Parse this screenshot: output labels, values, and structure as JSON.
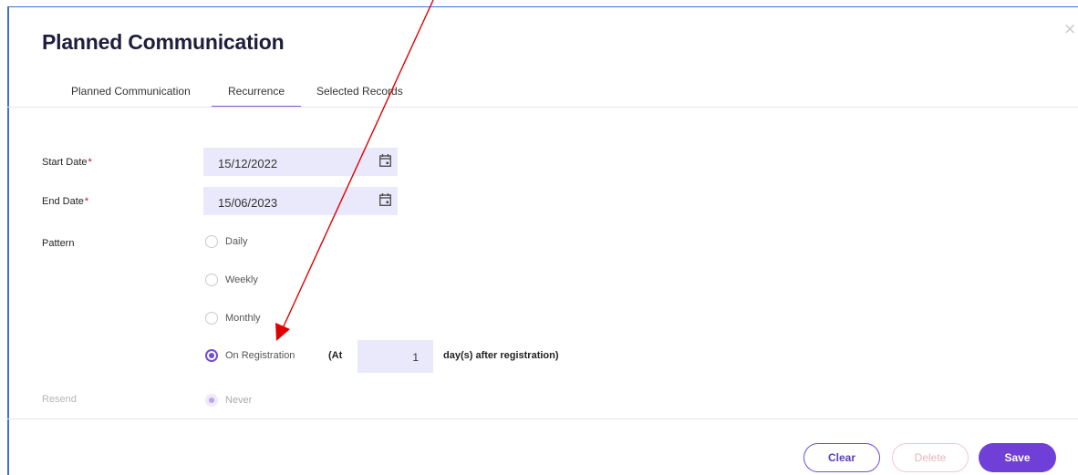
{
  "dialog": {
    "title": "Planned Communication",
    "close_symbol": "×"
  },
  "tabs": [
    {
      "label": "Planned Communication",
      "active": false
    },
    {
      "label": "Recurrence",
      "active": true
    },
    {
      "label": "Selected Records",
      "active": false
    }
  ],
  "form": {
    "start_date": {
      "label": "Start Date",
      "required_mark": "*",
      "value": "15/12/2022",
      "icon": "calendar-icon"
    },
    "end_date": {
      "label": "End Date",
      "required_mark": "*",
      "value": "15/06/2023",
      "icon": "calendar-icon"
    },
    "pattern": {
      "label": "Pattern",
      "options": [
        {
          "label": "Daily",
          "selected": false
        },
        {
          "label": "Weekly",
          "selected": false
        },
        {
          "label": "Monthly",
          "selected": false
        },
        {
          "label": "On Registration",
          "selected": true
        }
      ],
      "registration": {
        "prefix": "(At",
        "days_value": "1",
        "suffix": "day(s) after registration)"
      }
    },
    "resend": {
      "label": "Resend",
      "option": {
        "label": "Never",
        "selected": true,
        "disabled": true
      }
    }
  },
  "footer": {
    "clear_label": "Clear",
    "delete_label": "Delete",
    "save_label": "Save"
  },
  "colors": {
    "accent": "#6f4fd1",
    "save_bg": "#6f3fd8",
    "input_bg": "#e9e9fb",
    "annotation_arrow": "#e00000",
    "required": "#d0021b"
  }
}
